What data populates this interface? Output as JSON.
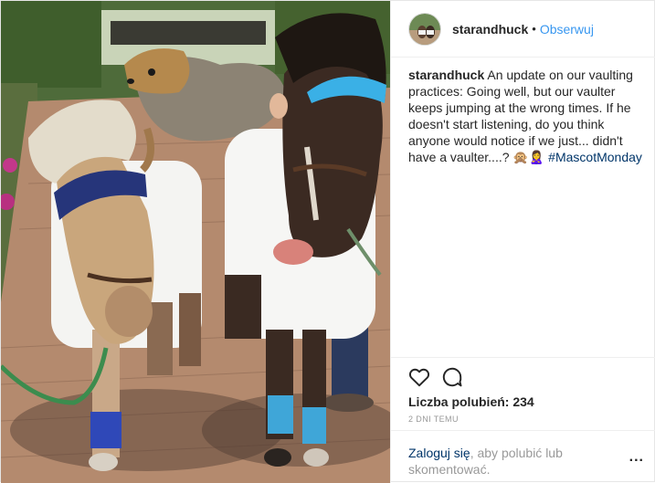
{
  "post": {
    "username": "starandhuck",
    "separator": "•",
    "follow_label": "Obserwuj",
    "caption": {
      "username": "starandhuck",
      "text": "An update on our vaulting practices: Going well, but our vaulter keeps jumping at the wrong times. If he doesn't start listening, do you think anyone would notice if we just... didn't have a vaulter....? 🙊🙎‍♀️",
      "hashtag": "#MascotMonday"
    },
    "likes_label": "Liczba polubień: 234",
    "time_label": "2 dni temu",
    "login": {
      "link_label": "Zaloguj się",
      "rest_text": ", aby polubić lub skomentować."
    },
    "more_label": "..."
  },
  "icons": {
    "like": "heart-icon",
    "comment": "comment-icon",
    "more": "more-options-icon"
  },
  "colors": {
    "link_blue": "#3897f0",
    "hashtag_blue": "#003569",
    "muted_gray": "#999999"
  }
}
